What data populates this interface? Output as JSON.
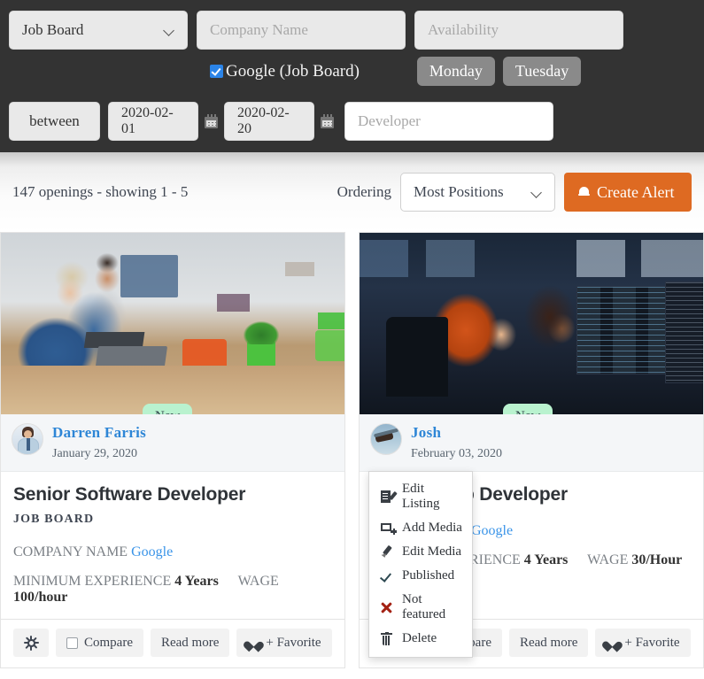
{
  "filters": {
    "source_select": {
      "value": "Job Board",
      "icon": "chevron-down-icon"
    },
    "company_input": {
      "value": "",
      "placeholder": "Company Name"
    },
    "availability_input": {
      "value": "",
      "placeholder": "Availability"
    },
    "checkbox": {
      "label": "Google (Job Board)",
      "checked": true
    },
    "days": [
      "Monday",
      "Tuesday"
    ],
    "date_operator": "between",
    "date_from": "2020-02-01",
    "date_to": "2020-02-20",
    "keyword_input": {
      "value": "",
      "placeholder": "Developer"
    },
    "calendar_icon": "calendar-icon"
  },
  "results": {
    "summary": "147 openings - showing 1 - 5",
    "ordering_label": "Ordering",
    "ordering_value": "Most Positions",
    "create_alert_label": "Create Alert",
    "bell_icon": "bell-icon",
    "accent_color": "#de6a22"
  },
  "cards": [
    {
      "badge": "New",
      "poster_name": "Darren Farris",
      "posted_date": "January 29, 2020",
      "title": "Senior Software Developer",
      "category": "JOB BOARD",
      "company_label": "COMPANY NAME",
      "company_value": "Google",
      "experience_label": "MINIMUM EXPERIENCE",
      "experience_value": "4 Years",
      "wage_label": "WAGE",
      "wage_value": "100/hour",
      "actions": {
        "gear": "gear-icon",
        "compare": "Compare",
        "read_more": "Read more",
        "favorite": "+ Favorite"
      }
    },
    {
      "badge": "New",
      "poster_name": "Josh",
      "posted_date": "February 03, 2020",
      "title": "b Developer",
      "category": "",
      "company_label": "",
      "company_value": "Google",
      "experience_label": "RIENCE",
      "experience_value": "4 Years",
      "wage_label": "WAGE",
      "wage_value": "30/Hour",
      "actions": {
        "gear": "gear-icon",
        "compare": "Compare",
        "read_more": "Read more",
        "favorite": "+ Favorite"
      }
    }
  ],
  "context_menu": {
    "items": [
      {
        "label": "Edit Listing",
        "icon": "edit-listing-icon"
      },
      {
        "label": "Add Media",
        "icon": "add-media-icon"
      },
      {
        "label": "Edit Media",
        "icon": "edit-media-pencil-icon"
      },
      {
        "label": "Published",
        "icon": "check-icon"
      },
      {
        "label": "Not featured",
        "icon": "x-icon"
      },
      {
        "label": "Delete",
        "icon": "trash-icon"
      }
    ]
  }
}
